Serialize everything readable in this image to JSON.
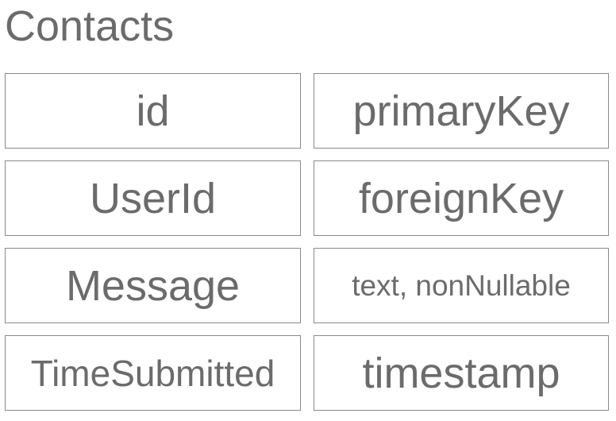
{
  "table": {
    "name": "Contacts",
    "rows": [
      {
        "field": "id",
        "type": "primaryKey"
      },
      {
        "field": "UserId",
        "type": "foreignKey"
      },
      {
        "field": "Message",
        "type": "text, nonNullable"
      },
      {
        "field": "TimeSubmitted",
        "type": "timestamp"
      }
    ]
  }
}
